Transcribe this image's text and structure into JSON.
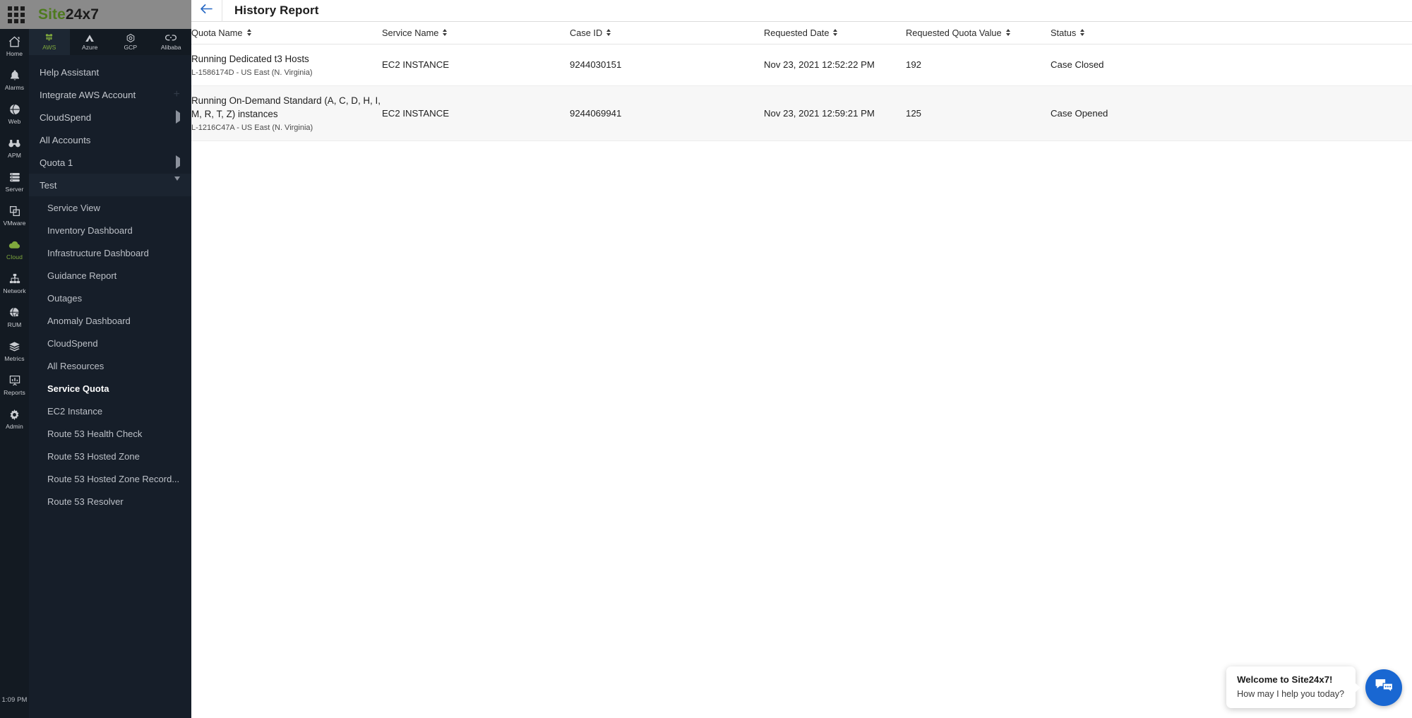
{
  "topbar": {
    "waffle_icon": "apps-grid-icon",
    "brand_prefix": "Site",
    "brand_suffix": "24x7",
    "brand_color": "#4e7a1e"
  },
  "rail": {
    "clock": "1:09 PM",
    "items": [
      {
        "label": "Home",
        "icon": "home-icon",
        "active": false
      },
      {
        "label": "Alarms",
        "icon": "bell-icon",
        "active": false
      },
      {
        "label": "Web",
        "icon": "globe-icon",
        "active": false
      },
      {
        "label": "APM",
        "icon": "binoculars-icon",
        "active": false
      },
      {
        "label": "Server",
        "icon": "server-icon",
        "active": false
      },
      {
        "label": "VMware",
        "icon": "windows-stack-icon",
        "active": false
      },
      {
        "label": "Cloud",
        "icon": "cloud-icon",
        "active": true
      },
      {
        "label": "Network",
        "icon": "network-icon",
        "active": false
      },
      {
        "label": "RUM",
        "icon": "globe-search-icon",
        "active": false
      },
      {
        "label": "Metrics",
        "icon": "layers-icon",
        "active": false
      },
      {
        "label": "Reports",
        "icon": "presentation-chart-icon",
        "active": false
      },
      {
        "label": "Admin",
        "icon": "gear-icon",
        "active": false
      }
    ]
  },
  "cloud_tabs": [
    {
      "label": "AWS",
      "icon": "aws-icon",
      "active": true
    },
    {
      "label": "Azure",
      "icon": "azure-icon",
      "active": false
    },
    {
      "label": "GCP",
      "icon": "gcp-icon",
      "active": false
    },
    {
      "label": "Alibaba",
      "icon": "alibaba-icon",
      "active": false
    }
  ],
  "sidebar": {
    "top_items": [
      {
        "label": "Help Assistant",
        "tail": "none"
      },
      {
        "label": "Integrate AWS Account",
        "tail": "plus"
      },
      {
        "label": "CloudSpend",
        "tail": "caret-right"
      },
      {
        "label": "All Accounts",
        "tail": "none"
      },
      {
        "label": "Quota 1",
        "tail": "caret-right"
      },
      {
        "label": "Test",
        "tail": "caret-down",
        "expanded": true
      }
    ],
    "sub_items": [
      {
        "label": "Service View",
        "current": false
      },
      {
        "label": "Inventory Dashboard",
        "current": false
      },
      {
        "label": "Infrastructure Dashboard",
        "current": false
      },
      {
        "label": "Guidance Report",
        "current": false
      },
      {
        "label": "Outages",
        "current": false
      },
      {
        "label": "Anomaly Dashboard",
        "current": false
      },
      {
        "label": "CloudSpend",
        "current": false
      },
      {
        "label": "All Resources",
        "current": false
      },
      {
        "label": "Service Quota",
        "current": true
      },
      {
        "label": "EC2 Instance",
        "current": false
      },
      {
        "label": "Route 53 Health Check",
        "current": false
      },
      {
        "label": "Route 53 Hosted Zone",
        "current": false
      },
      {
        "label": "Route 53 Hosted Zone Record...",
        "current": false
      },
      {
        "label": "Route 53 Resolver",
        "current": false
      }
    ]
  },
  "page": {
    "back_icon": "arrow-left-icon",
    "title": "History Report"
  },
  "table": {
    "columns": [
      {
        "label": "Quota Name",
        "sortable": true
      },
      {
        "label": "Service Name",
        "sortable": true
      },
      {
        "label": "Case ID",
        "sortable": true
      },
      {
        "label": "Requested Date",
        "sortable": true
      },
      {
        "label": "Requested Quota Value",
        "sortable": true
      },
      {
        "label": "Status",
        "sortable": true
      }
    ],
    "rows": [
      {
        "quota_name": "Running Dedicated t3 Hosts",
        "quota_code": "L-1586174D - US East (N. Virginia)",
        "service_name": "EC2 INSTANCE",
        "case_id": "9244030151",
        "requested_date": "Nov 23, 2021 12:52:22 PM",
        "requested_quota_value": "192",
        "status": "Case Closed"
      },
      {
        "quota_name": "Running On-Demand Standard (A, C, D, H, I, M, R, T, Z) instances",
        "quota_code": "L-1216C47A - US East (N. Virginia)",
        "service_name": "EC2 INSTANCE",
        "case_id": "9244069941",
        "requested_date": "Nov 23, 2021 12:59:21 PM",
        "requested_quota_value": "125",
        "status": "Case Opened"
      }
    ]
  },
  "chat": {
    "title": "Welcome to Site24x7!",
    "subtitle": "How may I help you today?",
    "fab_icon": "chat-bubbles-icon",
    "fab_color": "#1967d2"
  }
}
